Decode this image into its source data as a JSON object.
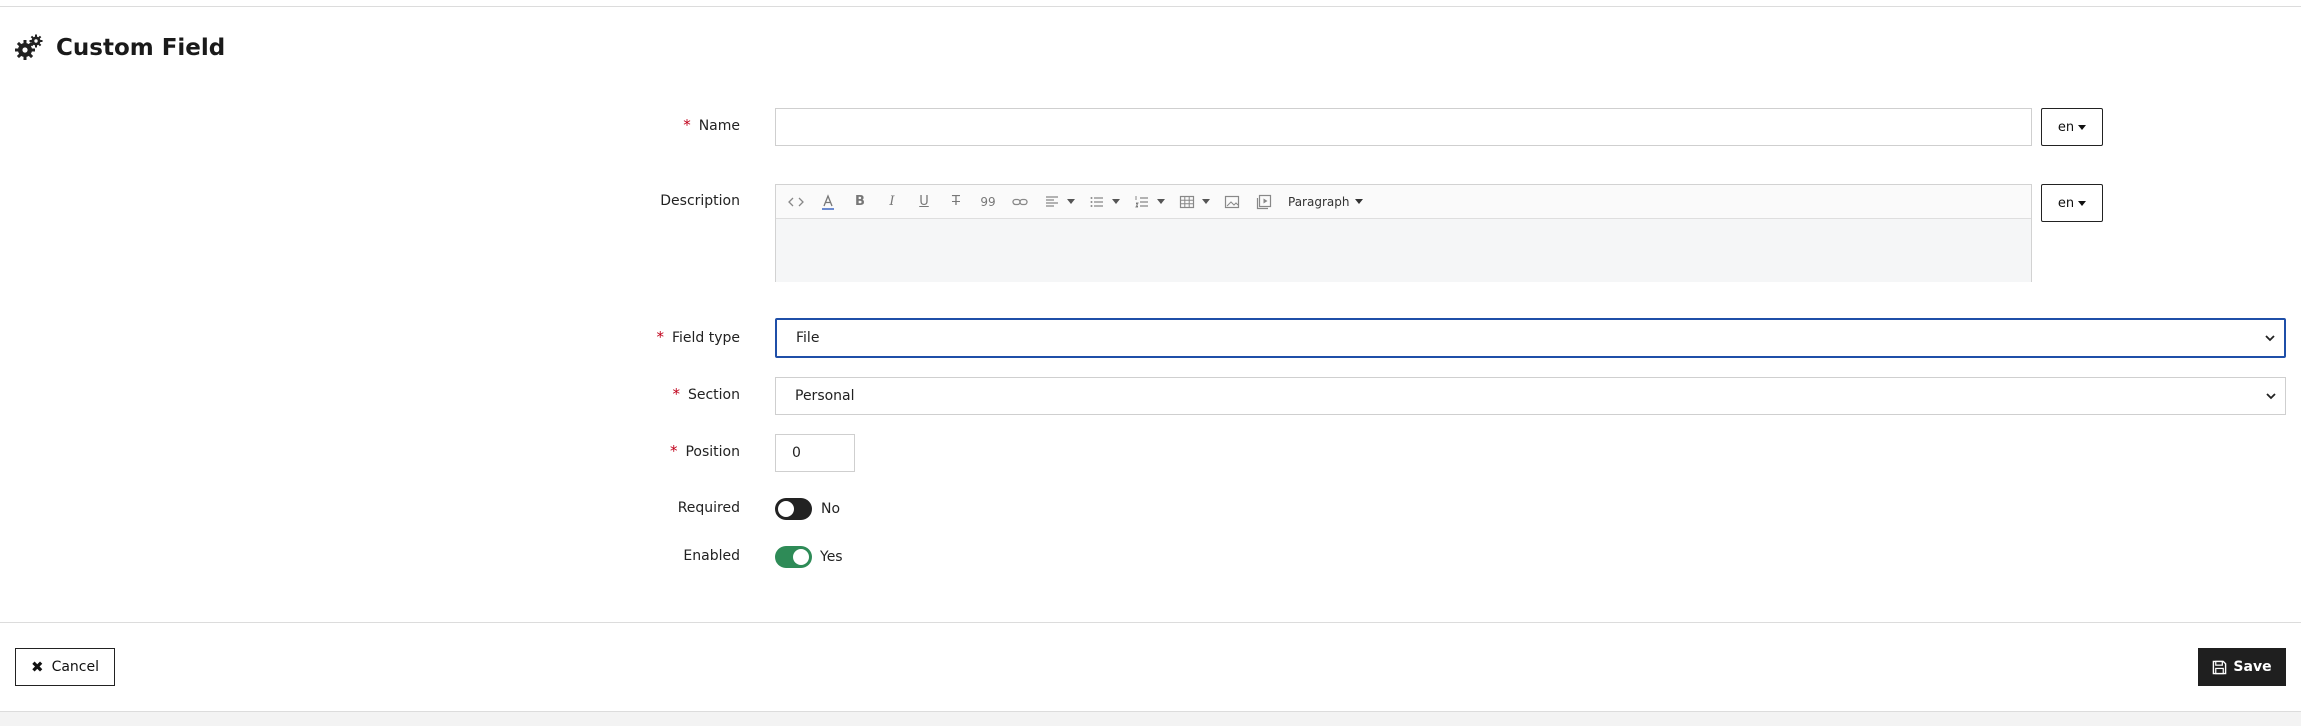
{
  "header": {
    "title": "Custom Field",
    "icon": "gears-icon"
  },
  "form": {
    "name": {
      "label": "Name",
      "required": true,
      "value": "",
      "lang": "en"
    },
    "description": {
      "label": "Description",
      "lang": "en",
      "toolbar": {
        "paragraph_label": "Paragraph",
        "quote_glyph": "99"
      }
    },
    "field_type": {
      "label": "Field type",
      "required": true,
      "value": "File"
    },
    "section": {
      "label": "Section",
      "required": true,
      "value": "Personal"
    },
    "position": {
      "label": "Position",
      "required": true,
      "value": "0"
    },
    "required_toggle": {
      "label": "Required",
      "state_text": "No",
      "on": false
    },
    "enabled_toggle": {
      "label": "Enabled",
      "state_text": "Yes",
      "on": true
    }
  },
  "footer": {
    "cancel_label": "Cancel",
    "save_label": "Save"
  },
  "colors": {
    "toggle_on": "#2e8b57",
    "toggle_off": "#222222",
    "focus_border": "#1f4fa8",
    "required_star": "#c0001a",
    "save_bg": "#1f1f1f"
  }
}
